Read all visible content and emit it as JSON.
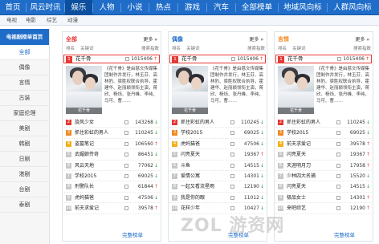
{
  "topnav": {
    "items": [
      "首页",
      "风云时讯",
      "娱乐",
      "人物",
      "小说",
      "热点",
      "游戏",
      "汽车",
      "全部榜单",
      "地域风向标",
      "人群风向标"
    ],
    "active": "娱乐"
  },
  "subnav": {
    "items": [
      "电视",
      "电影",
      "综艺",
      "动漫"
    ]
  },
  "sidebar": {
    "title": "电视剧榜单首页",
    "items": [
      "全部",
      "偶像",
      "言情",
      "古装",
      "家庭伦理",
      "美剧",
      "韩剧",
      "日剧",
      "港剧",
      "台剧",
      "泰剧"
    ],
    "active": "全部"
  },
  "panels": [
    {
      "title": "全部",
      "title_color": "#e53935",
      "more": "更多 »",
      "columns": [
        "排名",
        "关键词",
        "搜索指数"
      ],
      "featured": {
        "rank": "1",
        "name": "花千骨",
        "value": "1015406",
        "trend": "up"
      },
      "poster_text": "花千骨",
      "description": "《花千骨》是由慈文传媒集团制作并发行，林玉芬、高林豹、梁胜权联合执导，霍建华、赵丽颖领衔主演，蒋欣、杨烁、张丹峰、李纯、马可、曹……",
      "rows": [
        {
          "rank": "2",
          "name": "旋风少女",
          "value": "143268",
          "trend": "down"
        },
        {
          "rank": "3",
          "name": "抓住彩虹的男人",
          "value": "110245",
          "trend": "down"
        },
        {
          "rank": "4",
          "name": "盗墓笔记",
          "value": "106560",
          "trend": "up"
        },
        {
          "rank": "5",
          "name": "武媚娘传奇",
          "value": "86451",
          "trend": "down"
        },
        {
          "rank": "6",
          "name": "风云天地",
          "value": "77062",
          "trend": "down"
        },
        {
          "rank": "7",
          "name": "学校2015",
          "value": "69025",
          "trend": "down"
        },
        {
          "rank": "8",
          "name": "刑警队长",
          "value": "61844",
          "trend": "up"
        },
        {
          "rank": "9",
          "name": "虎妈猫爸",
          "value": "47506",
          "trend": "down"
        },
        {
          "rank": "10",
          "name": "前夫求爱记",
          "value": "39578",
          "trend": "up"
        }
      ],
      "full_link": "完整榜单"
    },
    {
      "title": "偶像",
      "title_color": "#1f6dc9",
      "more": "更多 »",
      "columns": [
        "排名",
        "关键词",
        "搜索指数"
      ],
      "featured": {
        "rank": "1",
        "name": "花千骨",
        "value": "1015406",
        "trend": "up"
      },
      "poster_text": "花千骨",
      "description": "《花千骨》是由慈文传媒集团制作并发行，林玉芬、高林豹、梁胜权联合执导，霍建华、赵丽颖领衔主演，蒋欣、杨烁、张丹峰、李纯、马可、曹……",
      "rows": [
        {
          "rank": "2",
          "name": "抓住彩虹的男人",
          "value": "110245",
          "trend": "down"
        },
        {
          "rank": "3",
          "name": "学校2015",
          "value": "69025",
          "trend": "down"
        },
        {
          "rank": "4",
          "name": "虎妈猫爸",
          "value": "47506",
          "trend": "down"
        },
        {
          "rank": "5",
          "name": "闪亮夏天",
          "value": "19367",
          "trend": "up"
        },
        {
          "rank": "6",
          "name": "斗鱼",
          "value": "14515",
          "trend": "down"
        },
        {
          "rank": "7",
          "name": "爱情公寓",
          "value": "14301",
          "trend": "down"
        },
        {
          "rank": "8",
          "name": "一起又看流星雨",
          "value": "12190",
          "trend": "down"
        },
        {
          "rank": "9",
          "name": "我是你的眼",
          "value": "11012",
          "trend": "down"
        },
        {
          "rank": "10",
          "name": "花样少年",
          "value": "10427",
          "trend": "down"
        }
      ],
      "full_link": "完整榜单"
    },
    {
      "title": "言情",
      "title_color": "#f08a24",
      "more": "更多 »",
      "columns": [
        "排名",
        "关键词",
        "搜索指数"
      ],
      "featured": {
        "rank": "1",
        "name": "花千骨",
        "value": "1015406",
        "trend": "up"
      },
      "poster_text": "花千骨",
      "description": "《花千骨》是由慈文传媒集团制作并发行，林玉芬、高林豹、梁胜权联合执导，霍建华、赵丽颖领衔主演，蒋欣、杨烁、张丹峰、李纯、马可、曹……",
      "rows": [
        {
          "rank": "2",
          "name": "抓住彩虹的男人",
          "value": "110245",
          "trend": "down"
        },
        {
          "rank": "3",
          "name": "学校2015",
          "value": "69025",
          "trend": "down"
        },
        {
          "rank": "4",
          "name": "前夫求爱记",
          "value": "39578",
          "trend": "up"
        },
        {
          "rank": "5",
          "name": "闪亮夏天",
          "value": "19367",
          "trend": "up"
        },
        {
          "rank": "6",
          "name": "天涯明月刀",
          "value": "17958",
          "trend": "up"
        },
        {
          "rank": "7",
          "name": "少林四大名捕",
          "value": "15520",
          "trend": "down"
        },
        {
          "rank": "8",
          "name": "闪亮夏天",
          "value": "14515",
          "trend": "down"
        },
        {
          "rank": "9",
          "name": "极品女士",
          "value": "14301",
          "trend": "up"
        },
        {
          "rank": "10",
          "name": "来吧综艺",
          "value": "12190",
          "trend": "up"
        }
      ],
      "full_link": "完整榜单"
    }
  ],
  "watermark": "ZOL 游资网"
}
